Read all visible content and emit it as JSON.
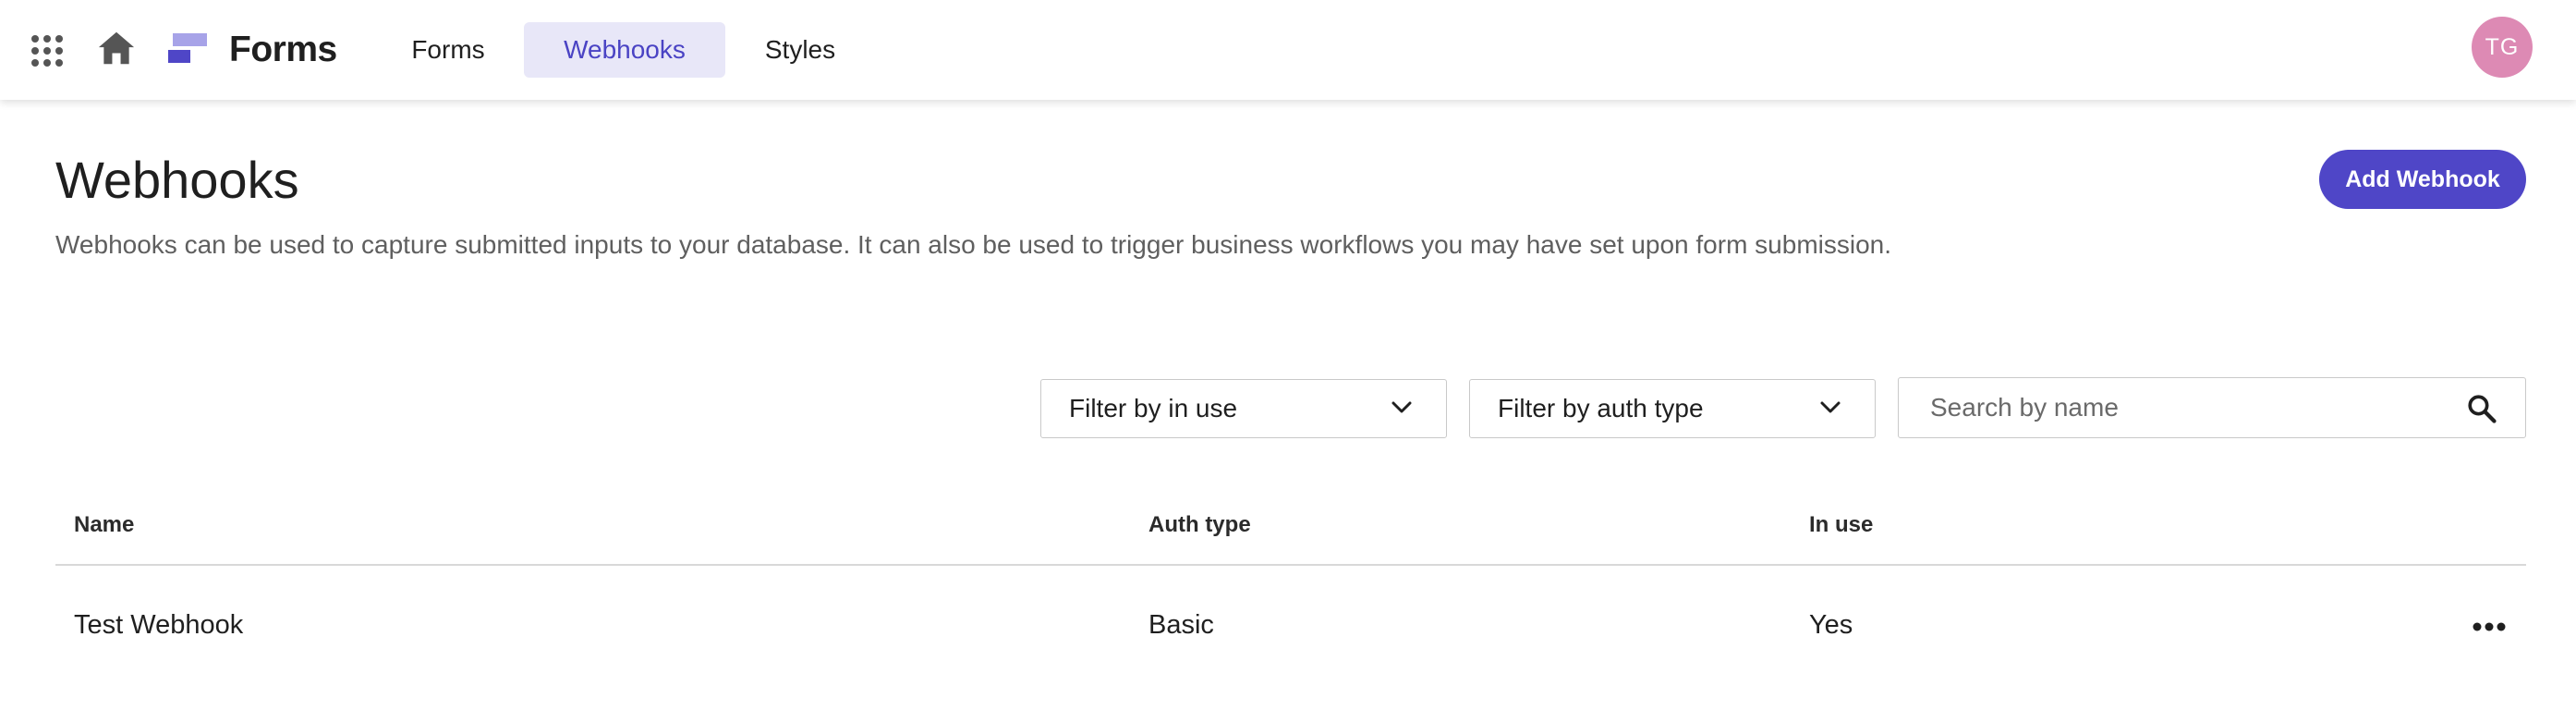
{
  "header": {
    "app_title": "Forms",
    "apps_icon": "apps-grid-icon",
    "home_icon": "home-icon",
    "logo_icon": "forms-logo-icon",
    "tabs": [
      {
        "label": "Forms",
        "active": false
      },
      {
        "label": "Webhooks",
        "active": true
      },
      {
        "label": "Styles",
        "active": false
      }
    ],
    "avatar_initials": "TG"
  },
  "page": {
    "title": "Webhooks",
    "description": "Webhooks can be used to capture submitted inputs to your database. It can also be used to trigger business workflows you may have set upon form submission.",
    "add_button_label": "Add Webhook"
  },
  "filters": {
    "in_use": {
      "label": "Filter by in use"
    },
    "auth_type": {
      "label": "Filter by auth type"
    },
    "search": {
      "placeholder": "Search by name",
      "value": ""
    }
  },
  "table": {
    "columns": [
      "Name",
      "Auth type",
      "In use"
    ],
    "rows": [
      {
        "name": "Test Webhook",
        "auth_type": "Basic",
        "in_use": "Yes"
      }
    ]
  },
  "colors": {
    "accent": "#4f46c7",
    "accent_soft": "#e8e7f8",
    "logo_light": "#a7a3e8",
    "avatar": "#dd8ab4"
  }
}
